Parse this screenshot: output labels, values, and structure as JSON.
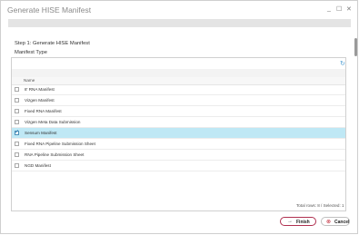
{
  "window": {
    "title": "Generate HISE Manifest",
    "controls": {
      "minimize": "_",
      "maximize": "☐",
      "close": "✕"
    }
  },
  "step_label": "Step 1: Generate HISE Manifest",
  "manifest_type_label": "Manifest Type",
  "grid": {
    "column_header": "Name",
    "rows": [
      {
        "label": "8' RNA Manifest",
        "selected": false
      },
      {
        "label": "Vizgen Manifest",
        "selected": false
      },
      {
        "label": "Fixed RNA Manifest",
        "selected": false
      },
      {
        "label": "Vizgen Meta Data Submission",
        "selected": false
      },
      {
        "label": "Sensum Manifest",
        "selected": true
      },
      {
        "label": "Fixed RNA Pipeline Submission Sheet",
        "selected": false
      },
      {
        "label": "RNA Pipeline Submission Sheet",
        "selected": false
      },
      {
        "label": "NGD Manifest",
        "selected": false
      }
    ],
    "totals": "Total rows: 8 / Selected: 1",
    "icons": {
      "refresh": "refresh-icon",
      "filter": "filter-icon"
    }
  },
  "buttons": {
    "finish": "Finish",
    "cancel": "Cancel"
  },
  "colors": {
    "selected_row": "#bfe8f5",
    "finish_border": "#b03050",
    "cancel_icon": "#c02030",
    "refresh_icon": "#4a9bd1"
  }
}
